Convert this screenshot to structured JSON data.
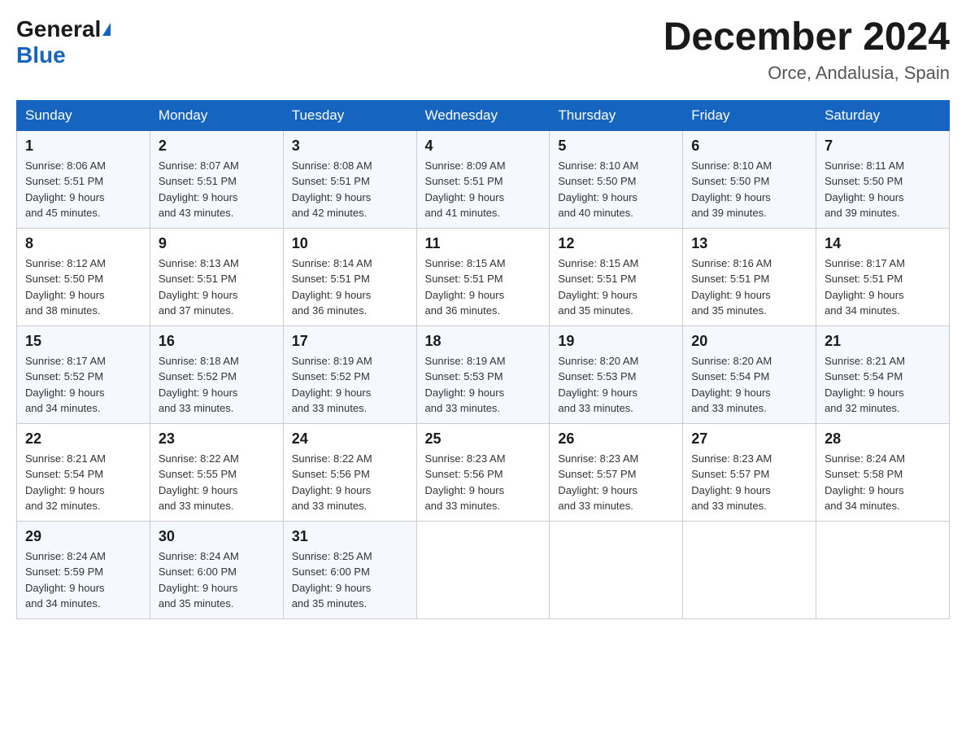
{
  "header": {
    "logo_general": "General",
    "logo_blue": "Blue",
    "month_title": "December 2024",
    "location": "Orce, Andalusia, Spain"
  },
  "days_of_week": [
    "Sunday",
    "Monday",
    "Tuesday",
    "Wednesday",
    "Thursday",
    "Friday",
    "Saturday"
  ],
  "weeks": [
    [
      {
        "day": "1",
        "sunrise": "8:06 AM",
        "sunset": "5:51 PM",
        "daylight": "9 hours and 45 minutes."
      },
      {
        "day": "2",
        "sunrise": "8:07 AM",
        "sunset": "5:51 PM",
        "daylight": "9 hours and 43 minutes."
      },
      {
        "day": "3",
        "sunrise": "8:08 AM",
        "sunset": "5:51 PM",
        "daylight": "9 hours and 42 minutes."
      },
      {
        "day": "4",
        "sunrise": "8:09 AM",
        "sunset": "5:51 PM",
        "daylight": "9 hours and 41 minutes."
      },
      {
        "day": "5",
        "sunrise": "8:10 AM",
        "sunset": "5:50 PM",
        "daylight": "9 hours and 40 minutes."
      },
      {
        "day": "6",
        "sunrise": "8:10 AM",
        "sunset": "5:50 PM",
        "daylight": "9 hours and 39 minutes."
      },
      {
        "day": "7",
        "sunrise": "8:11 AM",
        "sunset": "5:50 PM",
        "daylight": "9 hours and 39 minutes."
      }
    ],
    [
      {
        "day": "8",
        "sunrise": "8:12 AM",
        "sunset": "5:50 PM",
        "daylight": "9 hours and 38 minutes."
      },
      {
        "day": "9",
        "sunrise": "8:13 AM",
        "sunset": "5:51 PM",
        "daylight": "9 hours and 37 minutes."
      },
      {
        "day": "10",
        "sunrise": "8:14 AM",
        "sunset": "5:51 PM",
        "daylight": "9 hours and 36 minutes."
      },
      {
        "day": "11",
        "sunrise": "8:15 AM",
        "sunset": "5:51 PM",
        "daylight": "9 hours and 36 minutes."
      },
      {
        "day": "12",
        "sunrise": "8:15 AM",
        "sunset": "5:51 PM",
        "daylight": "9 hours and 35 minutes."
      },
      {
        "day": "13",
        "sunrise": "8:16 AM",
        "sunset": "5:51 PM",
        "daylight": "9 hours and 35 minutes."
      },
      {
        "day": "14",
        "sunrise": "8:17 AM",
        "sunset": "5:51 PM",
        "daylight": "9 hours and 34 minutes."
      }
    ],
    [
      {
        "day": "15",
        "sunrise": "8:17 AM",
        "sunset": "5:52 PM",
        "daylight": "9 hours and 34 minutes."
      },
      {
        "day": "16",
        "sunrise": "8:18 AM",
        "sunset": "5:52 PM",
        "daylight": "9 hours and 33 minutes."
      },
      {
        "day": "17",
        "sunrise": "8:19 AM",
        "sunset": "5:52 PM",
        "daylight": "9 hours and 33 minutes."
      },
      {
        "day": "18",
        "sunrise": "8:19 AM",
        "sunset": "5:53 PM",
        "daylight": "9 hours and 33 minutes."
      },
      {
        "day": "19",
        "sunrise": "8:20 AM",
        "sunset": "5:53 PM",
        "daylight": "9 hours and 33 minutes."
      },
      {
        "day": "20",
        "sunrise": "8:20 AM",
        "sunset": "5:54 PM",
        "daylight": "9 hours and 33 minutes."
      },
      {
        "day": "21",
        "sunrise": "8:21 AM",
        "sunset": "5:54 PM",
        "daylight": "9 hours and 32 minutes."
      }
    ],
    [
      {
        "day": "22",
        "sunrise": "8:21 AM",
        "sunset": "5:54 PM",
        "daylight": "9 hours and 32 minutes."
      },
      {
        "day": "23",
        "sunrise": "8:22 AM",
        "sunset": "5:55 PM",
        "daylight": "9 hours and 33 minutes."
      },
      {
        "day": "24",
        "sunrise": "8:22 AM",
        "sunset": "5:56 PM",
        "daylight": "9 hours and 33 minutes."
      },
      {
        "day": "25",
        "sunrise": "8:23 AM",
        "sunset": "5:56 PM",
        "daylight": "9 hours and 33 minutes."
      },
      {
        "day": "26",
        "sunrise": "8:23 AM",
        "sunset": "5:57 PM",
        "daylight": "9 hours and 33 minutes."
      },
      {
        "day": "27",
        "sunrise": "8:23 AM",
        "sunset": "5:57 PM",
        "daylight": "9 hours and 33 minutes."
      },
      {
        "day": "28",
        "sunrise": "8:24 AM",
        "sunset": "5:58 PM",
        "daylight": "9 hours and 34 minutes."
      }
    ],
    [
      {
        "day": "29",
        "sunrise": "8:24 AM",
        "sunset": "5:59 PM",
        "daylight": "9 hours and 34 minutes."
      },
      {
        "day": "30",
        "sunrise": "8:24 AM",
        "sunset": "6:00 PM",
        "daylight": "9 hours and 35 minutes."
      },
      {
        "day": "31",
        "sunrise": "8:25 AM",
        "sunset": "6:00 PM",
        "daylight": "9 hours and 35 minutes."
      },
      null,
      null,
      null,
      null
    ]
  ]
}
